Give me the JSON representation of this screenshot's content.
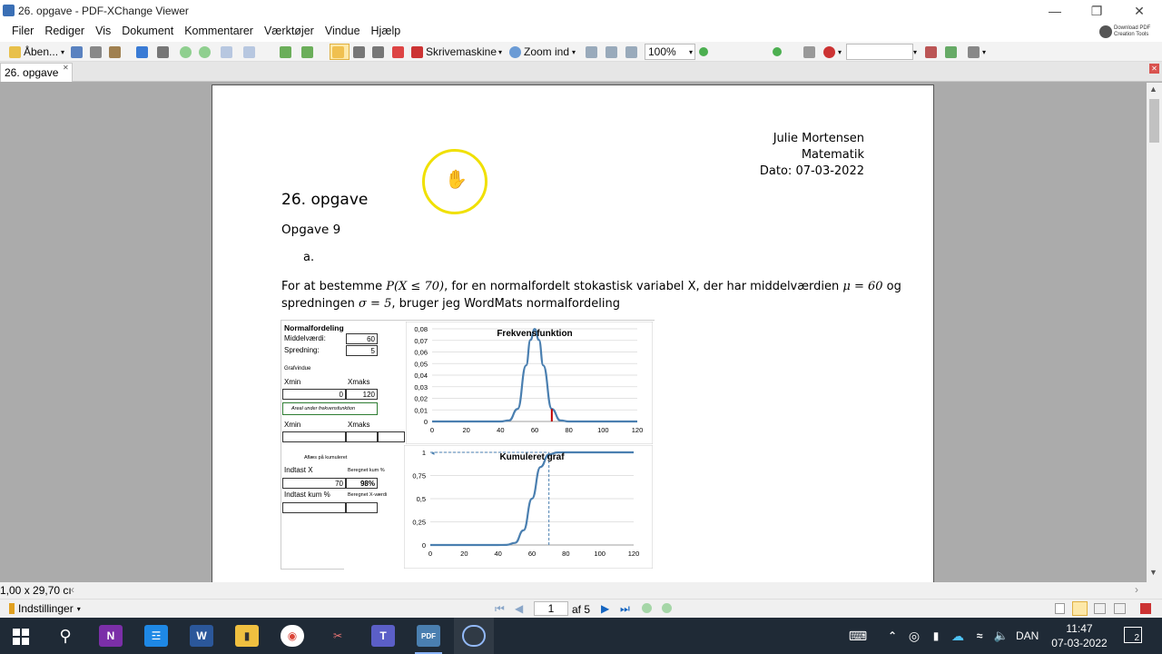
{
  "window": {
    "title": "26. opgave - PDF-XChange Viewer",
    "download_label_1": "Download PDF",
    "download_label_2": "Creation Tools"
  },
  "menu": [
    "Filer",
    "Rediger",
    "Vis",
    "Dokument",
    "Kommentarer",
    "Værktøjer",
    "Vindue",
    "Hjælp"
  ],
  "toolbar": {
    "open_label": "Åben...",
    "typewriter_label": "Skrivemaskine",
    "zoom_in_label": "Zoom ind",
    "zoom_value": "100%"
  },
  "tab": {
    "label": "26. opgave"
  },
  "document": {
    "author": "Julie Mortensen",
    "subject": "Matematik",
    "date": "Dato: 07-03-2022",
    "heading": "26. opgave",
    "subheading": "Opgave 9",
    "list_marker": "a.",
    "para_line1_a": "For at bestemme ",
    "para_line1_math": "P(X ≤ 70)",
    "para_line1_b": ", for en normalfordelt stokastisk variabel X, der har middelværdien ",
    "para_line1_mu": "μ = 60",
    "para_line1_c": " og",
    "para_line2_a": "spredningen ",
    "para_line2_sigma": "σ = 5",
    "para_line2_b": ", bruger jeg WordMats normalfordeling"
  },
  "panel": {
    "title": "Normalfordeling",
    "mean_label": "Middelværdi:",
    "mean_value": "60",
    "sd_label": "Spredning:",
    "sd_value": "5",
    "graph_window": "Grafvindue",
    "xmin": "Xmin",
    "xmax": "Xmaks",
    "xmin_value": "0",
    "xmax_value": "120",
    "area_label": "Areal under frekvensfunktion",
    "xmin2": "Xmin",
    "xmax2": "Xmaks",
    "read_label": "Aflæs på kumuleret",
    "input_x_label": "Indtast X",
    "calc_cum_label": "Beregnet kum %",
    "input_x_value": "70",
    "calc_cum_value": "98%",
    "input_cum_label": "Indtast kum %",
    "calc_x_label": "Beregnet X-værdi"
  },
  "chart_data": [
    {
      "type": "line",
      "title": "Frekvensfunktion",
      "x": [
        0,
        40,
        45,
        50,
        55,
        57.5,
        60,
        62.5,
        65,
        70,
        75,
        80,
        120
      ],
      "series": [
        {
          "values": [
            0,
            0,
            0.0009,
            0.0108,
            0.0484,
            0.0704,
            0.0798,
            0.0704,
            0.0484,
            0.0108,
            0.0009,
            0,
            0
          ]
        }
      ],
      "marker_x": 70,
      "xlim": [
        0,
        120
      ],
      "ylim": [
        0,
        0.08
      ],
      "xticks": [
        "0",
        "20",
        "40",
        "60",
        "80",
        "100",
        "120"
      ],
      "yticks": [
        "0",
        "0,01",
        "0,02",
        "0,03",
        "0,04",
        "0,05",
        "0,06",
        "0,07",
        "0,08"
      ],
      "grid": true
    },
    {
      "type": "line",
      "title": "Kumuleret graf",
      "x": [
        0,
        40,
        45,
        50,
        55,
        60,
        65,
        70,
        75,
        80,
        120
      ],
      "series": [
        {
          "values": [
            0,
            0,
            0.0013,
            0.0228,
            0.1587,
            0.5,
            0.8413,
            0.9772,
            0.9987,
            1,
            1
          ]
        }
      ],
      "marker_x": 70,
      "marker_y": 1,
      "xlim": [
        0,
        120
      ],
      "ylim": [
        0,
        1
      ],
      "xticks": [
        "0",
        "20",
        "40",
        "60",
        "80",
        "100",
        "120"
      ],
      "yticks": [
        "0",
        "0,25",
        "0,5",
        "0,75",
        "1"
      ],
      "grid": true
    }
  ],
  "status": {
    "page_size": "1,00 x 29,70 cı",
    "settings_label": "Indstillinger",
    "page_current": "1",
    "page_total": "af 5"
  },
  "taskbar": {
    "language": "DAN",
    "time": "11:47",
    "date": "07-03-2022",
    "notification_count": "2"
  },
  "colors": {
    "curve": "#4a7fb0",
    "marker": "#c00000",
    "cursor_ring": "#f0e000",
    "taskbar": "#1f2a36"
  }
}
